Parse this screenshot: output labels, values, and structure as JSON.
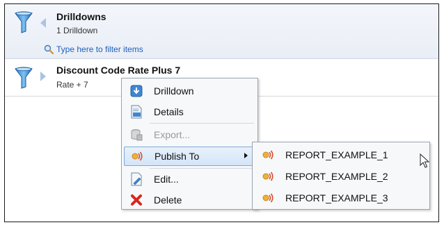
{
  "header": {
    "title": "Drilldowns",
    "subtitle": "1 Drilldown",
    "filter_placeholder": "Type here to filter items"
  },
  "item": {
    "title": "Discount Code Rate Plus 7",
    "subtitle": "Rate + 7"
  },
  "context_menu": {
    "items": [
      {
        "label": "Drilldown",
        "icon": "drilldown-arrow-icon",
        "enabled": true
      },
      {
        "label": "Details",
        "icon": "details-document-icon",
        "enabled": true
      },
      {
        "label": "Export...",
        "icon": "export-icon",
        "enabled": false
      },
      {
        "label": "Publish To",
        "icon": "publish-icon",
        "enabled": true,
        "has_submenu": true,
        "highlighted": true
      },
      {
        "label": "Edit...",
        "icon": "edit-document-icon",
        "enabled": true
      },
      {
        "label": "Delete",
        "icon": "delete-x-icon",
        "enabled": true
      }
    ]
  },
  "submenu": {
    "items": [
      {
        "label": "REPORT_EXAMPLE_1",
        "icon": "publish-icon"
      },
      {
        "label": "REPORT_EXAMPLE_2",
        "icon": "publish-icon"
      },
      {
        "label": "REPORT_EXAMPLE_3",
        "icon": "publish-icon"
      }
    ]
  },
  "colors": {
    "accent_blue": "#1f5fb7",
    "highlight_border": "#7fa9d8",
    "delete_red": "#d8261c"
  }
}
